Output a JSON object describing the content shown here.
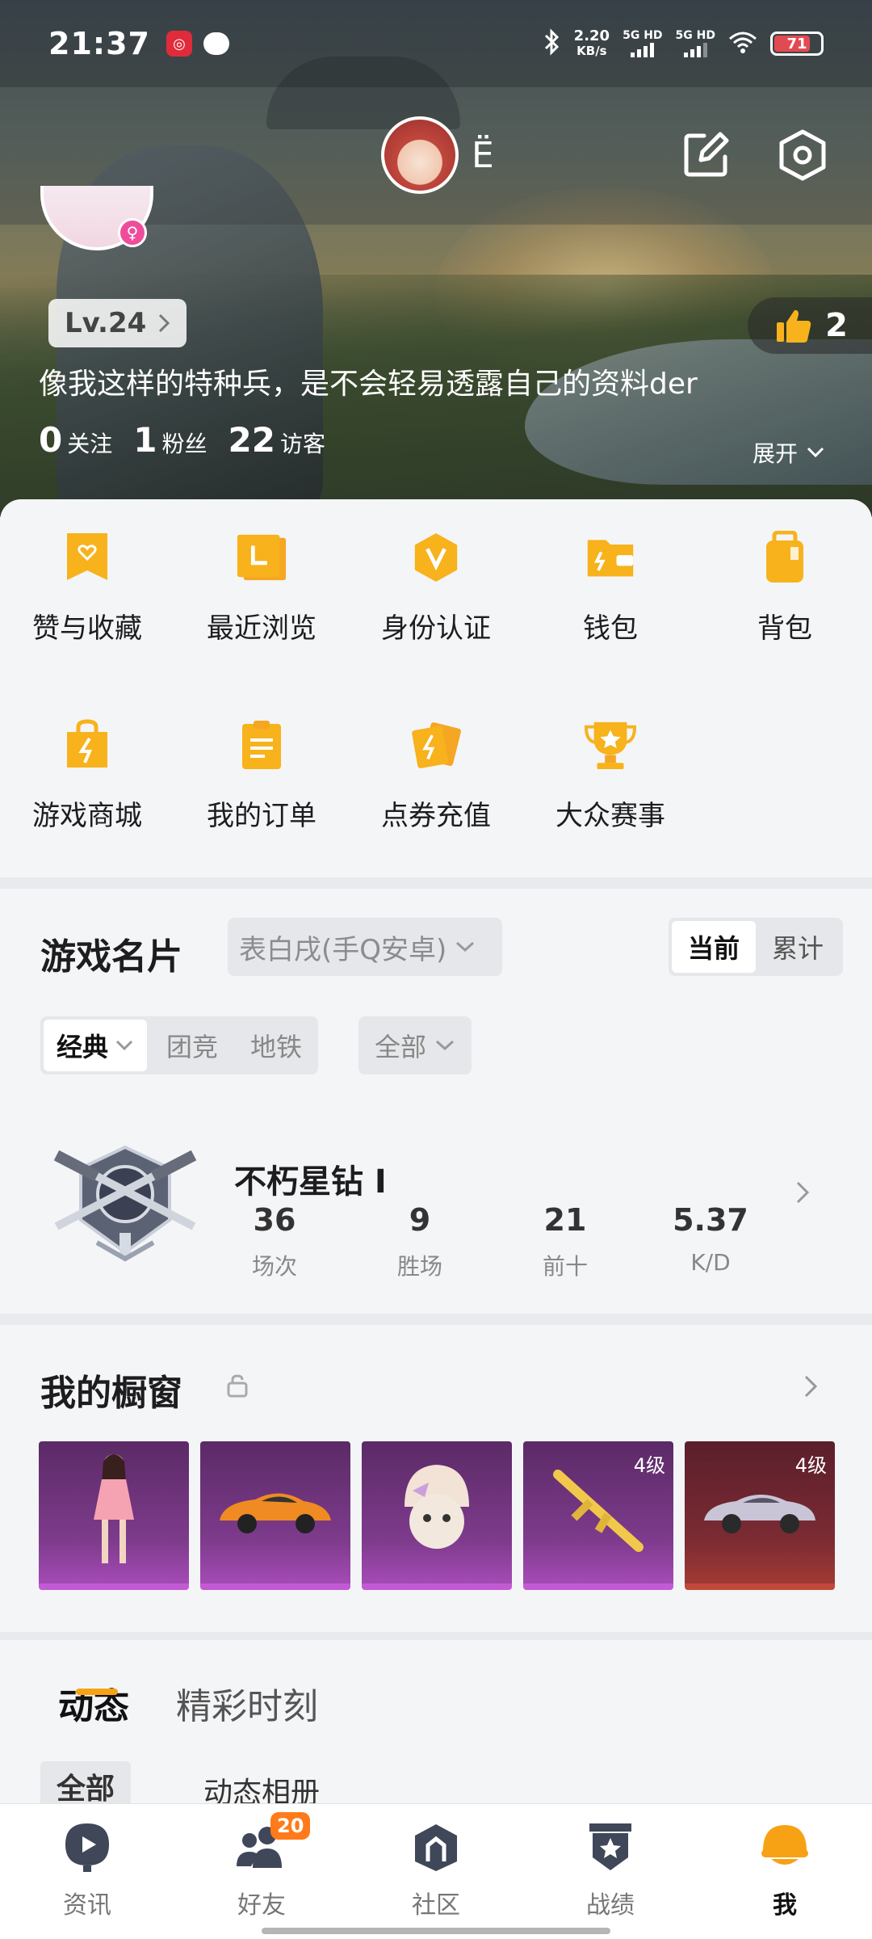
{
  "status_bar": {
    "time": "21:37",
    "net_speed_value": "2.20",
    "net_speed_unit": "KB/s",
    "sim1_label": "5G HD",
    "sim2_label": "5G HD",
    "battery": "71"
  },
  "header": {
    "nickname": "Ë",
    "level": "Lv.24",
    "likes": "2",
    "bio": "像我这样的特种兵，是不会轻易透露自己的资料der",
    "stats": [
      {
        "value": "0",
        "label": "关注"
      },
      {
        "value": "1",
        "label": "粉丝"
      },
      {
        "value": "22",
        "label": "访客"
      }
    ],
    "expand_label": "展开"
  },
  "menu": {
    "items": [
      {
        "label": "赞与收藏",
        "icon": "heart-bookmark-icon"
      },
      {
        "label": "最近浏览",
        "icon": "history-icon"
      },
      {
        "label": "身份认证",
        "icon": "verified-v-icon"
      },
      {
        "label": "钱包",
        "icon": "wallet-icon"
      },
      {
        "label": "背包",
        "icon": "backpack-icon"
      },
      {
        "label": "游戏商城",
        "icon": "shopping-bag-icon"
      },
      {
        "label": "我的订单",
        "icon": "order-list-icon"
      },
      {
        "label": "点券充值",
        "icon": "coupon-icon"
      },
      {
        "label": "大众赛事",
        "icon": "trophy-icon"
      }
    ],
    "accent_color": "#f7b21c"
  },
  "game_card": {
    "title": "游戏名片",
    "account": "表白戌(手Q安卓)",
    "toggle_current": "当前",
    "toggle_total": "累计",
    "modes": [
      "经典",
      "团竞",
      "地铁"
    ],
    "scope": "全部",
    "rank_name": "不朽星钻 I",
    "stats": [
      {
        "value": "36",
        "label": "场次"
      },
      {
        "value": "9",
        "label": "胜场"
      },
      {
        "value": "21",
        "label": "前十"
      },
      {
        "value": "5.37",
        "label": "K/D"
      }
    ]
  },
  "showcase": {
    "title": "我的橱窗",
    "items": [
      {
        "icon": "character-outfit-icon",
        "level": ""
      },
      {
        "icon": "sports-car-icon",
        "level": ""
      },
      {
        "icon": "helmet-outfit-icon",
        "level": ""
      },
      {
        "icon": "golden-rifle-icon",
        "level": "4级"
      },
      {
        "icon": "silver-car-icon",
        "level": "4级"
      }
    ]
  },
  "feed": {
    "tabs": [
      "动态",
      "精彩时刻"
    ],
    "sub_tabs": [
      "全部",
      "动态相册"
    ]
  },
  "bottom_nav": {
    "items": [
      {
        "label": "资讯",
        "icon": "news-icon"
      },
      {
        "label": "好友",
        "icon": "friends-icon",
        "badge": "20"
      },
      {
        "label": "社区",
        "icon": "community-icon"
      },
      {
        "label": "战绩",
        "icon": "record-icon"
      },
      {
        "label": "我",
        "icon": "me-helmet-icon"
      }
    ]
  }
}
